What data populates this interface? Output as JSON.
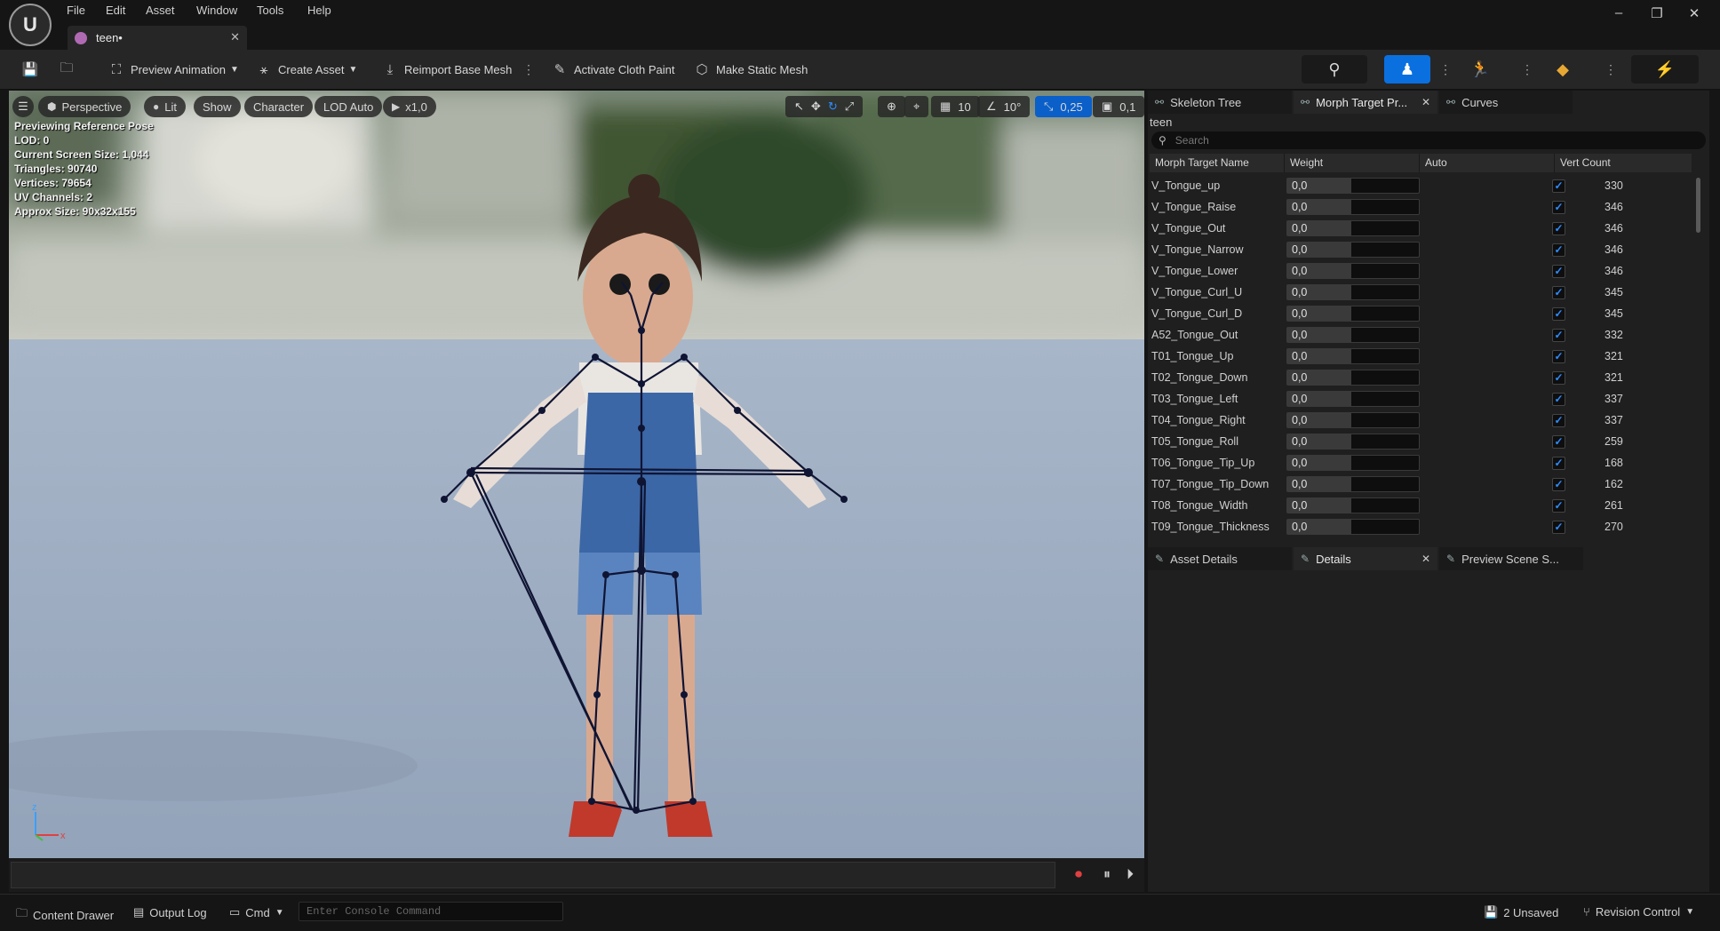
{
  "menu": [
    "File",
    "Edit",
    "Asset",
    "Window",
    "Tools",
    "Help"
  ],
  "doc_tab": {
    "label": "teen•"
  },
  "window_controls": {
    "minimize": "–",
    "restore": "❐",
    "close": "✕"
  },
  "toolbar": {
    "preview_animation": "Preview Animation",
    "create_asset": "Create Asset",
    "reimport": "Reimport Base Mesh",
    "cloth_paint": "Activate Cloth Paint",
    "static_mesh": "Make Static Mesh"
  },
  "viewport": {
    "perspective": "Perspective",
    "lit": "Lit",
    "show": "Show",
    "character": "Character",
    "lod": "LOD Auto",
    "speed": "x1,0",
    "grid_snap": "10",
    "rot_snap": "10°",
    "scale_snap": "0,25",
    "cam_speed": "0,1",
    "info": [
      "Previewing Reference Pose",
      "LOD: 0",
      "Current Screen Size: 1,044",
      "Triangles: 90740",
      "Vertices: 79654",
      "UV Channels: 2",
      "Approx Size: 90x32x155"
    ],
    "axis_x": "x",
    "axis_z": "z"
  },
  "panel_tabs": {
    "skeleton_tree": "Skeleton Tree",
    "morph_target": "Morph Target Pr...",
    "curves": "Curves"
  },
  "asset_name": "teen",
  "search_placeholder": "Search",
  "columns": {
    "name": "Morph Target Name",
    "weight": "Weight",
    "auto": "Auto",
    "vert_count": "Vert Count"
  },
  "morph_targets": [
    {
      "name": "V_Tongue_up",
      "weight": "0,0",
      "auto": true,
      "vc": "330"
    },
    {
      "name": "V_Tongue_Raise",
      "weight": "0,0",
      "auto": true,
      "vc": "346"
    },
    {
      "name": "V_Tongue_Out",
      "weight": "0,0",
      "auto": true,
      "vc": "346"
    },
    {
      "name": "V_Tongue_Narrow",
      "weight": "0,0",
      "auto": true,
      "vc": "346"
    },
    {
      "name": "V_Tongue_Lower",
      "weight": "0,0",
      "auto": true,
      "vc": "346"
    },
    {
      "name": "V_Tongue_Curl_U",
      "weight": "0,0",
      "auto": true,
      "vc": "345"
    },
    {
      "name": "V_Tongue_Curl_D",
      "weight": "0,0",
      "auto": true,
      "vc": "345"
    },
    {
      "name": "A52_Tongue_Out",
      "weight": "0,0",
      "auto": true,
      "vc": "332"
    },
    {
      "name": "T01_Tongue_Up",
      "weight": "0,0",
      "auto": true,
      "vc": "321"
    },
    {
      "name": "T02_Tongue_Down",
      "weight": "0,0",
      "auto": true,
      "vc": "321"
    },
    {
      "name": "T03_Tongue_Left",
      "weight": "0,0",
      "auto": true,
      "vc": "337"
    },
    {
      "name": "T04_Tongue_Right",
      "weight": "0,0",
      "auto": true,
      "vc": "337"
    },
    {
      "name": "T05_Tongue_Roll",
      "weight": "0,0",
      "auto": true,
      "vc": "259"
    },
    {
      "name": "T06_Tongue_Tip_Up",
      "weight": "0,0",
      "auto": true,
      "vc": "168"
    },
    {
      "name": "T07_Tongue_Tip_Down",
      "weight": "0,0",
      "auto": true,
      "vc": "162"
    },
    {
      "name": "T08_Tongue_Width",
      "weight": "0,0",
      "auto": true,
      "vc": "261"
    },
    {
      "name": "T09_Tongue_Thickness",
      "weight": "0,0",
      "auto": true,
      "vc": "270"
    }
  ],
  "details_tabs": {
    "asset_details": "Asset Details",
    "details": "Details",
    "preview_scene": "Preview Scene S..."
  },
  "status": {
    "content_drawer": "Content Drawer",
    "output_log": "Output Log",
    "cmd": "Cmd",
    "console_placeholder": "Enter Console Command",
    "unsaved": "2 Unsaved",
    "revision_control": "Revision Control"
  },
  "colors": {
    "accent": "#0a70e0",
    "checkbox": "#2f8cff"
  }
}
